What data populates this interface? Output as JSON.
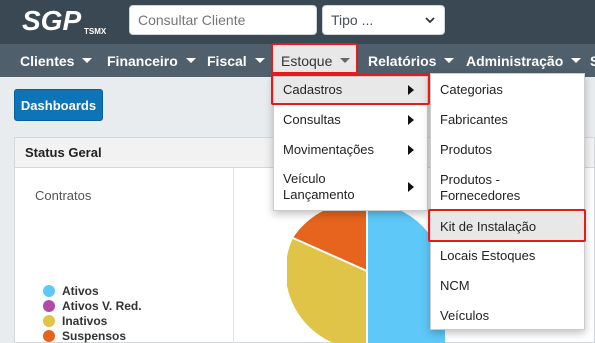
{
  "app": {
    "logo_main": "SGP",
    "logo_sub": "TSMX"
  },
  "topbar": {
    "search_placeholder": "Consultar Cliente",
    "type_select": "Tipo ..."
  },
  "navbar": {
    "items": [
      {
        "label": "Clientes"
      },
      {
        "label": "Financeiro"
      },
      {
        "label": "Fiscal"
      },
      {
        "label": "Estoque"
      },
      {
        "label": "Relatórios"
      },
      {
        "label": "Administração"
      },
      {
        "label": "S"
      }
    ]
  },
  "content": {
    "dashboards_button": "Dashboards",
    "panel_title": "Status Geral",
    "chart_label": "Contratos"
  },
  "estoque_menu": {
    "items": [
      {
        "label": "Cadastros"
      },
      {
        "label": "Consultas"
      },
      {
        "label": "Movimentações"
      },
      {
        "label": "Veículo Lançamento"
      }
    ]
  },
  "cadastros_submenu": {
    "items": [
      {
        "label": "Categorias"
      },
      {
        "label": "Fabricantes"
      },
      {
        "label": "Produtos"
      },
      {
        "label": "Produtos - Fornecedores"
      },
      {
        "label": "Kit de Instalação"
      },
      {
        "label": "Locais Estoques"
      },
      {
        "label": "NCM"
      },
      {
        "label": "Veículos"
      }
    ]
  },
  "chart_data": {
    "type": "pie",
    "title": "Contratos",
    "categories": [
      "Ativos",
      "Ativos V. Red.",
      "Inativos",
      "Suspensos"
    ],
    "colors": [
      "#5ec8f8",
      "#b44aa8",
      "#e0c447",
      "#e6641e"
    ],
    "legend_position": "bottom-left"
  },
  "colors": {
    "topbar": "#394853",
    "navbar": "#4f5f6b",
    "primary_button": "#0d74b8",
    "highlight": "#e31b1b"
  }
}
